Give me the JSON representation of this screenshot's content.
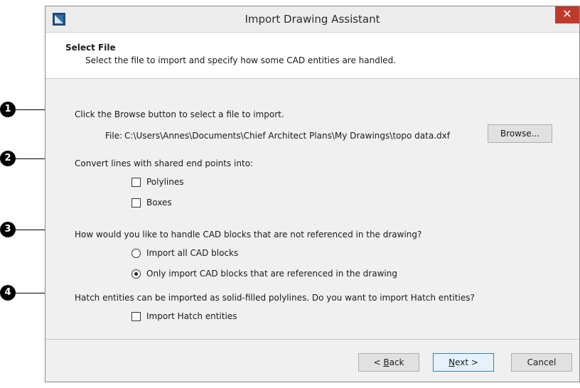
{
  "window": {
    "title": "Import Drawing Assistant",
    "close_symbol": "✕"
  },
  "header": {
    "title": "Select File",
    "subtitle": "Select the file to import and specify how some CAD entities are handled."
  },
  "step1": {
    "instruction": "Click the Browse button to select a file to import.",
    "file_label": "File:",
    "file_path": "C:\\Users\\Annes\\Documents\\Chief Architect Plans\\My Drawings\\topo data.dxf",
    "browse_label": "Browse..."
  },
  "step2": {
    "instruction": "Convert lines with shared end points into:",
    "polylines_label": "Polylines",
    "polylines_checked": false,
    "boxes_label": "Boxes",
    "boxes_checked": false
  },
  "step3": {
    "instruction": "How would you like to handle CAD blocks that are not referenced in the drawing?",
    "option_all": "Import all CAD blocks",
    "option_referenced": "Only import CAD blocks that are referenced in the drawing",
    "selected": "option_referenced"
  },
  "step4": {
    "instruction": "Hatch entities can be imported as solid-filled polylines. Do you want to import Hatch entities?",
    "import_hatch_label": "Import Hatch entities",
    "import_hatch_checked": false
  },
  "footer": {
    "back_prefix": "< ",
    "back_key": "B",
    "back_rest": "ack",
    "next_key": "N",
    "next_rest": "ext >",
    "cancel_label": "Cancel"
  },
  "callouts": [
    "1",
    "2",
    "3",
    "4"
  ],
  "colors": {
    "close_button": "#c0392b",
    "app_icon": "#1f4e79",
    "dialog_bg": "#f0f0f0"
  },
  "icons": {
    "app": "chief-architect-logo-icon",
    "close": "close-icon"
  }
}
